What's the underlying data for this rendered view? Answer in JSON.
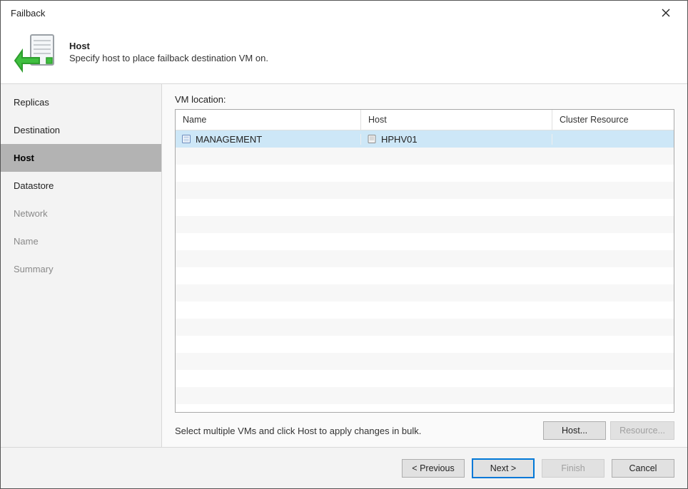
{
  "window": {
    "title": "Failback"
  },
  "header": {
    "title": "Host",
    "subtitle": "Specify host to place failback destination VM on."
  },
  "sidebar": {
    "items": [
      {
        "label": "Replicas",
        "state": "done"
      },
      {
        "label": "Destination",
        "state": "done"
      },
      {
        "label": "Host",
        "state": "current"
      },
      {
        "label": "Datastore",
        "state": "done"
      },
      {
        "label": "Network",
        "state": "inactive"
      },
      {
        "label": "Name",
        "state": "inactive"
      },
      {
        "label": "Summary",
        "state": "inactive"
      }
    ]
  },
  "main": {
    "vm_location_label": "VM location:",
    "columns": {
      "name": "Name",
      "host": "Host",
      "cluster": "Cluster Resource"
    },
    "rows": [
      {
        "name": "MANAGEMENT",
        "host": "HPHV01",
        "cluster": "",
        "selected": true
      }
    ],
    "hint": "Select multiple VMs and click Host to apply changes in bulk.",
    "host_button": "Host...",
    "resource_button": "Resource..."
  },
  "footer": {
    "previous": "< Previous",
    "next": "Next >",
    "finish": "Finish",
    "cancel": "Cancel"
  }
}
